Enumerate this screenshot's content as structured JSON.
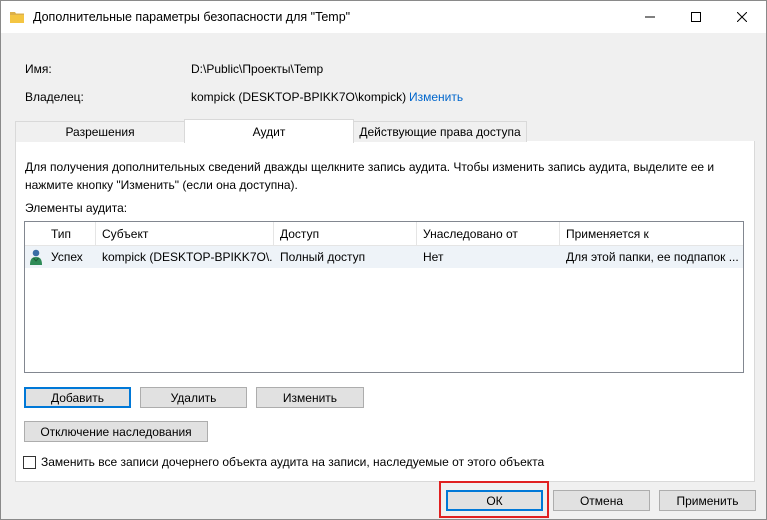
{
  "window": {
    "title": "Дополнительные параметры безопасности  для \"Temp\""
  },
  "fields": {
    "name_label": "Имя:",
    "name_value": "D:\\Public\\Проекты\\Temp",
    "owner_label": "Владелец:",
    "owner_value": "kompick (DESKTOP-BPIKK7O\\kompick)",
    "owner_change_link": "Изменить"
  },
  "tabs": [
    {
      "label": "Разрешения",
      "active": false
    },
    {
      "label": "Аудит",
      "active": true
    },
    {
      "label": "Действующие права доступа",
      "active": false
    }
  ],
  "audit": {
    "description": "Для получения дополнительных сведений дважды щелкните запись аудита. Чтобы изменить запись аудита, выделите ее и нажмите кнопку \"Изменить\" (если она доступна).",
    "entries_label": "Элементы аудита:",
    "columns": [
      "Тип",
      "Субъект",
      "Доступ",
      "Унаследовано от",
      "Применяется к"
    ],
    "rows": [
      {
        "icon": "user-icon",
        "type": "Успех",
        "subject": "kompick (DESKTOP-BPIKK7O\\...",
        "access": "Полный доступ",
        "inherited_from": "Нет",
        "applies_to": "Для этой папки, ее подпапок ..."
      }
    ],
    "add_button": "Добавить",
    "remove_button": "Удалить",
    "edit_button": "Изменить",
    "disable_inheritance_button": "Отключение наследования",
    "replace_checkbox_label": "Заменить все записи дочернего объекта аудита на записи, наследуемые от этого объекта",
    "replace_checked": false
  },
  "footer": {
    "ok_button": "ОК",
    "cancel_button": "Отмена",
    "apply_button": "Применить"
  },
  "colors": {
    "link": "#0066cc",
    "default_button_border": "#0078d7",
    "highlight_border": "#e02020",
    "folder_icon": "#f4c542"
  }
}
